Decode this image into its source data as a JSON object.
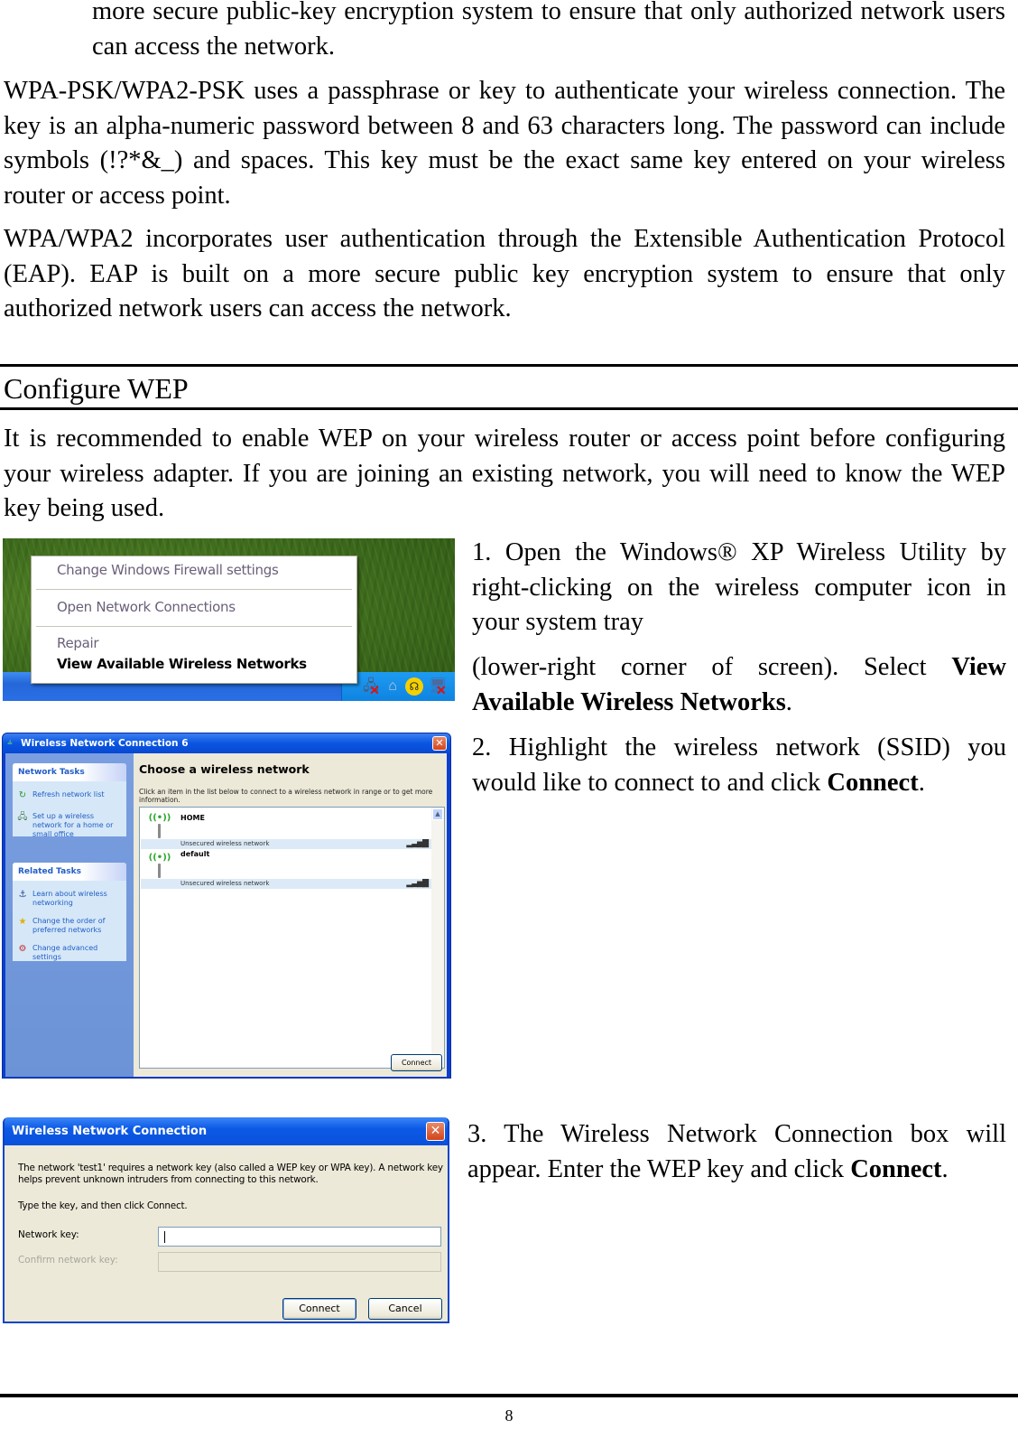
{
  "document": {
    "paragraphs": {
      "intro_continuation": "more secure public-key encryption system to ensure that only authorized network users can access the network.",
      "wpa_psk": "WPA-PSK/WPA2-PSK uses a passphrase or key to authenticate your wireless connection. The key is an alpha-numeric password between 8 and 63 characters long. The password can include symbols (!?*&_) and spaces. This key must be the exact same key entered on your wireless router or access point.",
      "wpa_eap": "WPA/WPA2 incorporates user authentication through the Extensible Authentication Protocol (EAP). EAP is built on a more secure public key encryption system to ensure that only authorized network users can access the network."
    },
    "section": {
      "heading": "Configure WEP",
      "intro": "It is recommended to enable WEP on your wireless router or access point before configuring your wireless adapter. If you are joining an existing network, you will need to know the WEP key being used."
    },
    "steps": [
      {
        "part1": "1. Open the Windows® XP Wireless Utility by right-clicking on the wireless computer icon in your system tray",
        "part2_prefix": "(lower-right corner of screen). Select ",
        "part2_bold": "View Available Wireless Networks",
        "part2_suffix": "."
      },
      {
        "prefix": "2. Highlight the wireless network (SSID) you would like to connect to and click ",
        "bold": "Connect",
        "suffix": "."
      },
      {
        "prefix": "3. The Wireless Network Connection box will appear. Enter the WEP key and click ",
        "bold": "Connect",
        "suffix": "."
      }
    ],
    "page_number": "8"
  },
  "screenshot_context_menu": {
    "items": [
      "Change Windows Firewall settings",
      "Open Network Connections",
      "Repair",
      "View Available Wireless Networks"
    ],
    "tray_icons": [
      "wireless-disconnected-icon",
      "home-icon",
      "stethoscope-icon",
      "network-disconnected-icon"
    ]
  },
  "screenshot_choose_network": {
    "window_title": "Wireless Network Connection 6",
    "network_tasks": {
      "heading": "Network Tasks",
      "items": [
        "Refresh network list",
        "Set up a wireless network for a home or small office"
      ]
    },
    "related_tasks": {
      "heading": "Related Tasks",
      "items": [
        "Learn about wireless networking",
        "Change the order of preferred networks",
        "Change advanced settings"
      ]
    },
    "main_title": "Choose a wireless network",
    "description": "Click an item in the list below to connect to a wireless network in range or to get more information.",
    "networks": [
      {
        "name": "HOME",
        "status": "Unsecured wireless network",
        "signal": "excellent"
      },
      {
        "name": "default",
        "status": "Unsecured wireless network",
        "signal": "excellent"
      }
    ],
    "connect_button": "Connect"
  },
  "screenshot_network_key": {
    "window_title": "Wireless Network Connection",
    "message": "The network 'test1' requires a network key (also called a WEP key or WPA key). A network key helps prevent unknown intruders from connecting to this network.",
    "instruction": "Type the key, and then click Connect.",
    "network_key_label": "Network key:",
    "network_key_value": "",
    "confirm_key_label": "Confirm network key:",
    "confirm_key_value": "",
    "connect_button": "Connect",
    "cancel_button": "Cancel"
  }
}
